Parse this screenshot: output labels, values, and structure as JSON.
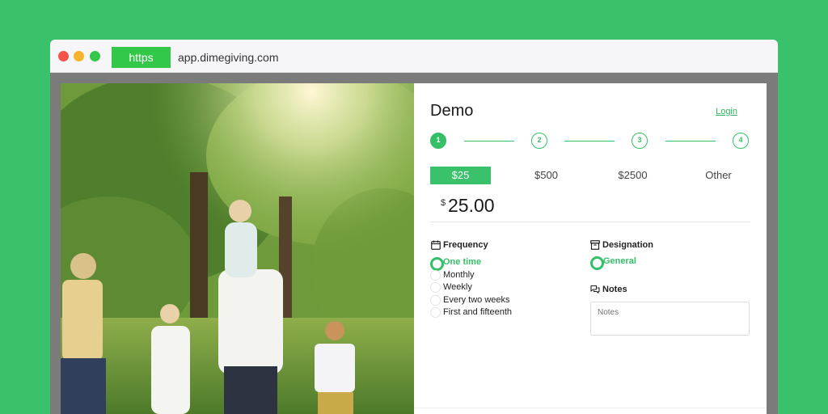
{
  "browser": {
    "protocol": "https",
    "url": "app.dimegiving.com"
  },
  "photo": {
    "alt_semantic": "family-walking-in-park-photo"
  },
  "form": {
    "title": "Demo",
    "login_label": "Login",
    "steps": [
      "1",
      "2",
      "3",
      "4"
    ],
    "active_step": 1,
    "amounts": [
      "$25",
      "$500",
      "$2500",
      "Other"
    ],
    "selected_amount_index": 0,
    "currency_symbol": "$",
    "amount_value": "25.00",
    "frequency": {
      "heading": "Frequency",
      "icon": "calendar-icon",
      "options": [
        "One time",
        "Monthly",
        "Weekly",
        "Every two weeks",
        "First and fifteenth"
      ],
      "selected_index": 0
    },
    "designation": {
      "heading": "Designation",
      "icon": "archive-box-icon",
      "options": [
        "General"
      ],
      "selected_index": 0
    },
    "notes": {
      "heading": "Notes",
      "icon": "chat-bubbles-icon",
      "placeholder": "Notes"
    }
  },
  "colors": {
    "background": "#39c16c",
    "accent": "#35bf66",
    "protocol_badge": "#33c84a"
  }
}
